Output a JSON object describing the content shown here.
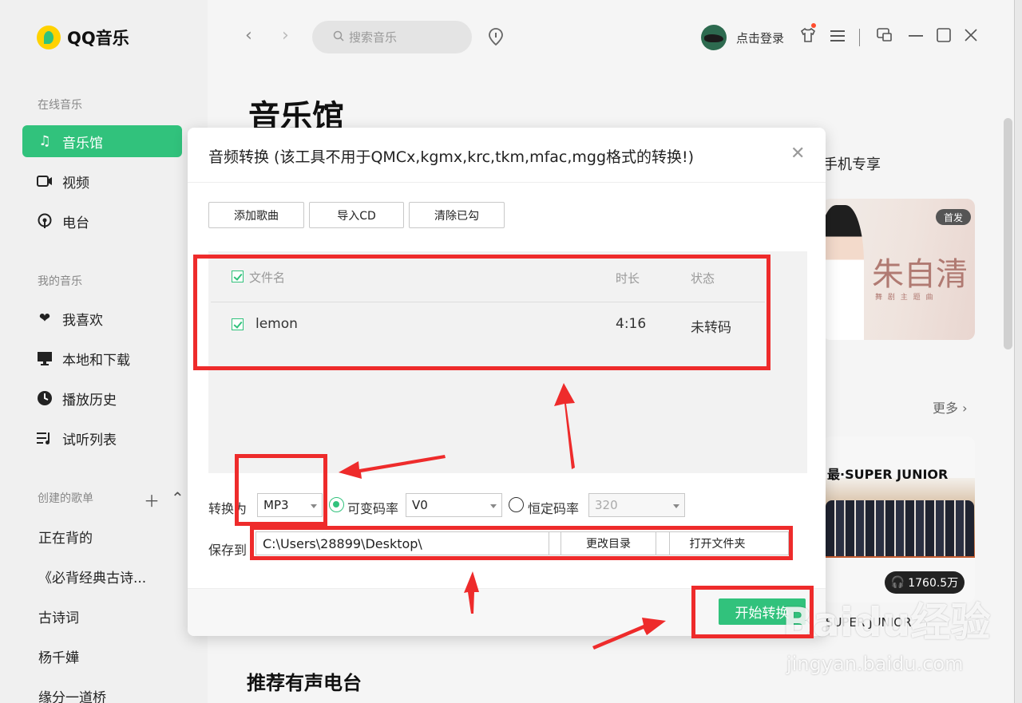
{
  "app": {
    "name": "QQ音乐"
  },
  "sidebar": {
    "online_section": "在线音乐",
    "online_items": [
      {
        "label": "音乐馆",
        "icon": "music-note-icon",
        "active": true
      },
      {
        "label": "视频",
        "icon": "video-icon"
      },
      {
        "label": "电台",
        "icon": "radio-icon"
      }
    ],
    "my_section": "我的音乐",
    "my_items": [
      {
        "label": "我喜欢",
        "icon": "heart-icon"
      },
      {
        "label": "本地和下载",
        "icon": "monitor-icon"
      },
      {
        "label": "播放历史",
        "icon": "clock-icon"
      },
      {
        "label": "试听列表",
        "icon": "playlist-icon"
      }
    ],
    "created_section": "创建的歌单",
    "playlists": [
      "正在背的",
      "《必背经典古诗...",
      "古诗词",
      "杨千嬅",
      "缘分一道桥"
    ]
  },
  "topbar": {
    "search_placeholder": "搜索音乐",
    "login": "点击登录"
  },
  "main": {
    "page_title": "音乐馆",
    "phone_exclusive": "手机专享",
    "card1_badge": "首发",
    "card1_art_text": "朱自清",
    "card1_art_sub": "舞 剧 主 题 曲",
    "more": "更多",
    "card2_head": "最·SUPER JUNIOR",
    "card2_plays": "1760.5万",
    "card2_label": "SUPER JUNIOR",
    "section_title": "推荐有声电台"
  },
  "dialog": {
    "title": "音频转换 (该工具不用于QMCx,kgmx,krc,tkm,mfac,mgg格式的转换!)",
    "buttons": {
      "add": "添加歌曲",
      "import_cd": "导入CD",
      "clear_checked": "清除已勾"
    },
    "columns": {
      "filename": "文件名",
      "duration": "时长",
      "status": "状态"
    },
    "rows": [
      {
        "filename": "lemon",
        "duration": "4:16",
        "status": "未转码",
        "checked": true
      }
    ],
    "convert_label": "转换为",
    "format": "MP3",
    "vbr_label": "可变码率",
    "vbr_value": "V0",
    "cbr_label": "恒定码率",
    "cbr_value": "320",
    "save_label": "保存到",
    "save_path": "C:\\Users\\28899\\Desktop\\",
    "change_dir": "更改目录",
    "open_folder": "打开文件夹",
    "start": "开始转换"
  },
  "watermark": {
    "main": "Baidu经验",
    "sub": "jingyan.baidu.com"
  },
  "colors": {
    "accent": "#31c27c",
    "annotation": "#ee2b2b"
  }
}
